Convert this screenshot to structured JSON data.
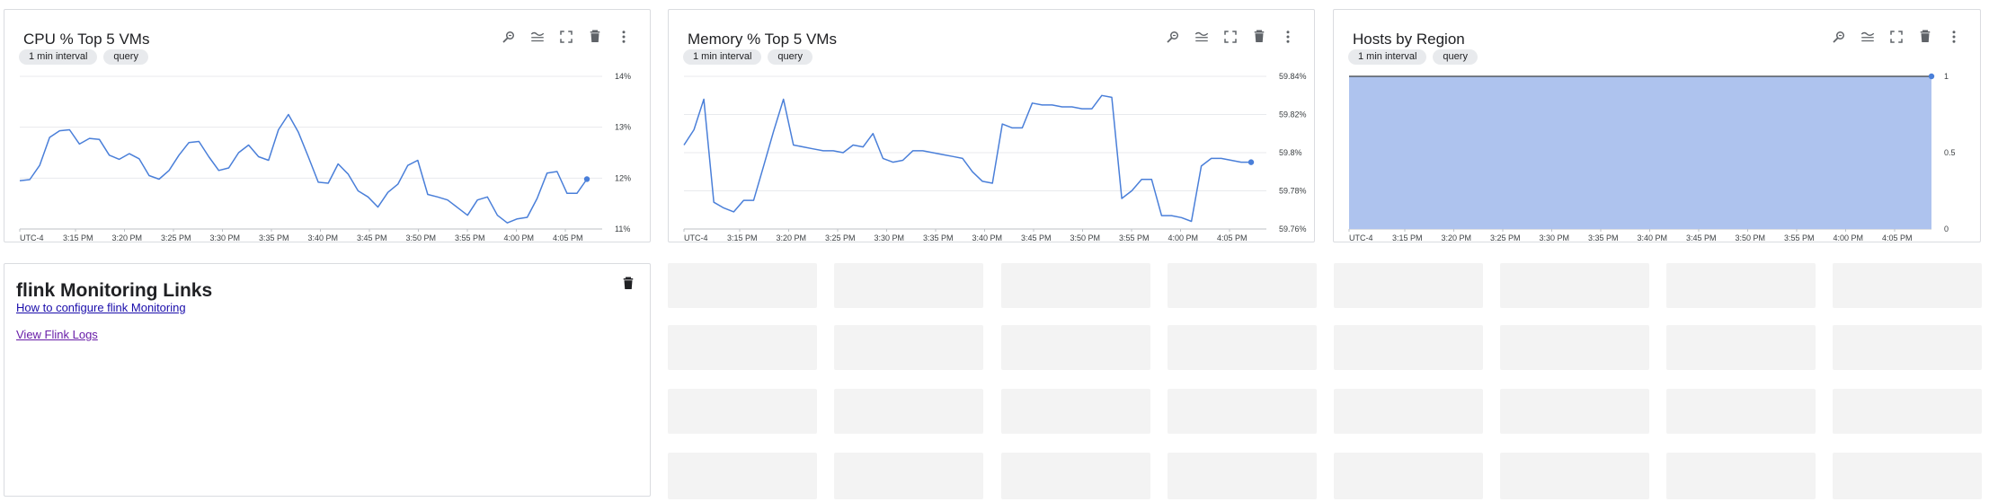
{
  "cards": [
    {
      "title": "CPU % Top 5 VMs",
      "chips": [
        "1 min interval",
        "query"
      ],
      "x_ticks": [
        "UTC-4",
        "3:15 PM",
        "3:20 PM",
        "3:25 PM",
        "3:30 PM",
        "3:35 PM",
        "3:40 PM",
        "3:45 PM",
        "3:50 PM",
        "3:55 PM",
        "4:00 PM",
        "4:05 PM"
      ],
      "y_ticks": [
        "14%",
        "13%",
        "12%",
        "11%"
      ]
    },
    {
      "title": "Memory % Top 5 VMs",
      "chips": [
        "1 min interval",
        "query"
      ],
      "x_ticks": [
        "UTC-4",
        "3:15 PM",
        "3:20 PM",
        "3:25 PM",
        "3:30 PM",
        "3:35 PM",
        "3:40 PM",
        "3:45 PM",
        "3:50 PM",
        "3:55 PM",
        "4:00 PM",
        "4:05 PM"
      ],
      "y_ticks": [
        "59.84%",
        "59.82%",
        "59.8%",
        "59.78%",
        "59.76%"
      ]
    },
    {
      "title": "Hosts by Region",
      "chips": [
        "1 min interval",
        "query"
      ],
      "x_ticks": [
        "UTC-4",
        "3:15 PM",
        "3:20 PM",
        "3:25 PM",
        "3:30 PM",
        "3:35 PM",
        "3:40 PM",
        "3:45 PM",
        "3:50 PM",
        "3:55 PM",
        "4:00 PM",
        "4:05 PM"
      ],
      "y_ticks": [
        "1",
        "0.5",
        "0"
      ]
    }
  ],
  "toolbar_icons": [
    "zoom-reset-icon",
    "legend-icon",
    "fullscreen-icon",
    "delete-icon",
    "more-vert-icon"
  ],
  "links_card": {
    "title": "flink Monitoring Links",
    "links": [
      "How to configure flink Monitoring",
      "View Flink Logs"
    ]
  },
  "colors": {
    "line": "#4a7fd9",
    "area_fill": "#aec3ee",
    "area_stroke": "#3c4043",
    "placeholder": "#f3f3f3"
  },
  "chart_data": [
    {
      "type": "line",
      "title": "CPU % Top 5 VMs",
      "x": [
        "3:10 PM",
        "3:11 PM",
        "3:12 PM",
        "3:13 PM",
        "3:14 PM",
        "3:15 PM",
        "3:16 PM",
        "3:17 PM",
        "3:18 PM",
        "3:19 PM",
        "3:20 PM",
        "3:21 PM",
        "3:22 PM",
        "3:23 PM",
        "3:24 PM",
        "3:25 PM",
        "3:26 PM",
        "3:27 PM",
        "3:28 PM",
        "3:29 PM",
        "3:30 PM",
        "3:31 PM",
        "3:32 PM",
        "3:33 PM",
        "3:34 PM",
        "3:35 PM",
        "3:36 PM",
        "3:37 PM",
        "3:38 PM",
        "3:39 PM",
        "3:40 PM",
        "3:41 PM",
        "3:42 PM",
        "3:43 PM",
        "3:44 PM",
        "3:45 PM",
        "3:46 PM",
        "3:47 PM",
        "3:48 PM",
        "3:49 PM",
        "3:50 PM",
        "3:51 PM",
        "3:52 PM",
        "3:53 PM",
        "3:54 PM",
        "3:55 PM",
        "3:56 PM",
        "3:57 PM",
        "3:58 PM",
        "3:59 PM",
        "4:00 PM",
        "4:01 PM",
        "4:02 PM",
        "4:03 PM",
        "4:04 PM",
        "4:05 PM",
        "4:06 PM",
        "4:07 PM"
      ],
      "values": [
        11.95,
        11.97,
        12.25,
        12.8,
        12.93,
        12.95,
        12.67,
        12.78,
        12.76,
        12.45,
        12.37,
        12.48,
        12.38,
        12.05,
        11.98,
        12.15,
        12.45,
        12.7,
        12.72,
        12.42,
        12.15,
        12.2,
        12.5,
        12.65,
        12.42,
        12.35,
        12.95,
        13.25,
        12.9,
        12.42,
        11.92,
        11.9,
        12.28,
        12.08,
        11.75,
        11.63,
        11.43,
        11.72,
        11.88,
        12.25,
        12.35,
        11.68,
        11.63,
        11.57,
        11.42,
        11.27,
        11.57,
        11.63,
        11.27,
        11.12,
        11.2,
        11.23,
        11.6,
        12.1,
        12.13,
        11.7,
        11.7,
        11.98
      ],
      "ylim": [
        11,
        14
      ],
      "xlabel": "",
      "ylabel": "",
      "grid": true
    },
    {
      "type": "line",
      "title": "Memory % Top 5 VMs",
      "x": [
        "3:10 PM",
        "3:11 PM",
        "3:12 PM",
        "3:13 PM",
        "3:14 PM",
        "3:15 PM",
        "3:16 PM",
        "3:17 PM",
        "3:18 PM",
        "3:19 PM",
        "3:20 PM",
        "3:21 PM",
        "3:22 PM",
        "3:23 PM",
        "3:24 PM",
        "3:25 PM",
        "3:26 PM",
        "3:27 PM",
        "3:28 PM",
        "3:29 PM",
        "3:30 PM",
        "3:31 PM",
        "3:32 PM",
        "3:33 PM",
        "3:34 PM",
        "3:35 PM",
        "3:36 PM",
        "3:37 PM",
        "3:38 PM",
        "3:39 PM",
        "3:40 PM",
        "3:41 PM",
        "3:42 PM",
        "3:43 PM",
        "3:44 PM",
        "3:45 PM",
        "3:46 PM",
        "3:47 PM",
        "3:48 PM",
        "3:49 PM",
        "3:50 PM",
        "3:51 PM",
        "3:52 PM",
        "3:53 PM",
        "3:54 PM",
        "3:55 PM",
        "3:56 PM",
        "3:57 PM",
        "3:58 PM",
        "3:59 PM",
        "4:00 PM",
        "4:01 PM",
        "4:02 PM",
        "4:03 PM",
        "4:04 PM",
        "4:05 PM",
        "4:06 PM",
        "4:07 PM"
      ],
      "values": [
        59.804,
        59.812,
        59.828,
        59.774,
        59.771,
        59.769,
        59.775,
        59.775,
        59.793,
        59.811,
        59.828,
        59.804,
        59.803,
        59.802,
        59.801,
        59.801,
        59.8,
        59.804,
        59.803,
        59.81,
        59.797,
        59.795,
        59.796,
        59.801,
        59.801,
        59.8,
        59.799,
        59.798,
        59.797,
        59.79,
        59.785,
        59.784,
        59.815,
        59.813,
        59.813,
        59.826,
        59.825,
        59.825,
        59.824,
        59.824,
        59.823,
        59.823,
        59.83,
        59.829,
        59.776,
        59.78,
        59.786,
        59.786,
        59.767,
        59.767,
        59.766,
        59.764,
        59.793,
        59.797,
        59.797,
        59.796,
        59.795,
        59.795
      ],
      "ylim": [
        59.76,
        59.84
      ],
      "xlabel": "",
      "ylabel": "",
      "grid": true
    },
    {
      "type": "area",
      "title": "Hosts by Region",
      "x": [
        "3:10 PM",
        "4:07 PM"
      ],
      "values": [
        1,
        1
      ],
      "ylim": [
        0,
        1
      ],
      "xlabel": "",
      "ylabel": "",
      "grid": false
    }
  ]
}
